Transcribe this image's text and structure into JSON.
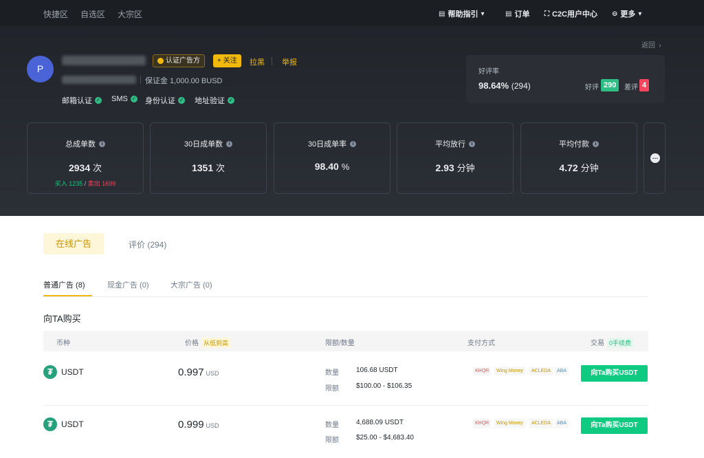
{
  "topnav": {
    "left": [
      "快捷区",
      "自选区",
      "大宗区"
    ],
    "help": "帮助指引",
    "orders": "订单",
    "c2c": "C2C用户中心",
    "more": "更多"
  },
  "back": "返回",
  "profile": {
    "avatar_letter": "P",
    "ad_badge": "认证广告方",
    "follow": "+ 关注",
    "block": "拉黑",
    "report": "举报",
    "deposit": "保证金 1,000.00 BUSD",
    "verifications": [
      "邮箱认证",
      "SMS",
      "身份认证",
      "地址验证"
    ]
  },
  "rating": {
    "label": "好评率",
    "value": "98.64%",
    "count": "(294)",
    "good_label": "好评",
    "good": "290",
    "bad_label": "差评",
    "bad": "4"
  },
  "stats": [
    {
      "title": "总成单数",
      "value": "2934",
      "unit": "次",
      "buy": "买入 1235",
      "sep": " / ",
      "sell": "卖出 1699"
    },
    {
      "title": "30日成单数",
      "value": "1351",
      "unit": "次"
    },
    {
      "title": "30日成单率",
      "value": "98.40",
      "unit": "%"
    },
    {
      "title": "平均放行",
      "value": "2.93",
      "unit": "分钟"
    },
    {
      "title": "平均付款",
      "value": "4.72",
      "unit": "分钟"
    }
  ],
  "tabs": {
    "online": "在线广告",
    "reviews": "评价 (294)"
  },
  "subtabs": [
    "普通广告 (8)",
    "现金广告 (0)",
    "大宗广告 (0)"
  ],
  "section_title": "向TA购买",
  "table": {
    "headers": {
      "coin": "币种",
      "price": "价格",
      "price_sort": "从低到高",
      "limit": "限额/数量",
      "payment": "支付方式",
      "trade": "交易",
      "fee": "0手续费"
    },
    "rows": [
      {
        "coin": "USDT",
        "price": "0.997",
        "currency": "USD",
        "qty_label": "数量",
        "qty": "106.68 USDT",
        "limit_label": "限额",
        "limit": "$100.00 - $106.35",
        "payments": [
          "KHQR",
          "Wing Money",
          "ACLEDA",
          "ABA"
        ],
        "button": "向Ta购买USDT"
      },
      {
        "coin": "USDT",
        "price": "0.999",
        "currency": "USD",
        "qty_label": "数量",
        "qty": "4,688.09 USDT",
        "limit_label": "限额",
        "limit": "$25.00 - $4,683.40",
        "payments": [
          "KHQR",
          "Wing Money",
          "ACLEDA",
          "ABA"
        ],
        "button": "向Ta购买USDT"
      }
    ]
  },
  "colors": {
    "accent": "#f0b90b",
    "buy_green": "#0ecb81",
    "sell_red": "#f6465d",
    "header_bg": "#1f2227"
  }
}
